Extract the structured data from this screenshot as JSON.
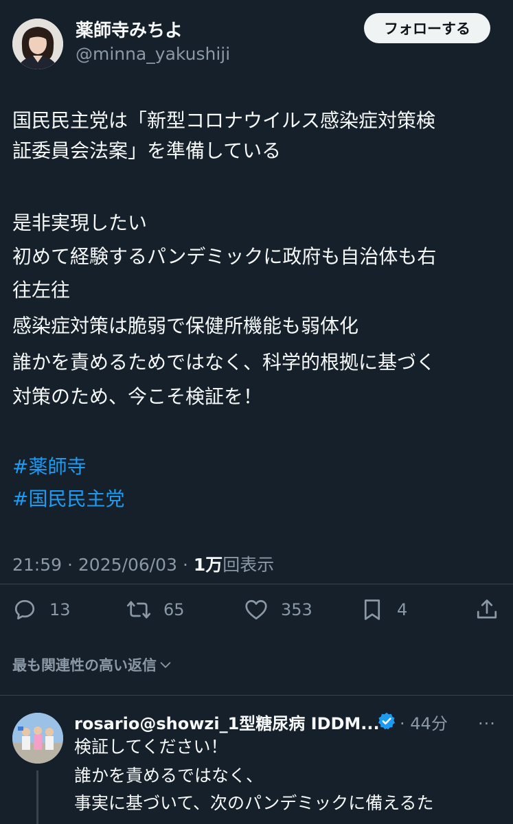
{
  "author": {
    "name": "薬師寺みちよ",
    "handle": "@minna_yakushiji"
  },
  "follow_button": "フォローする",
  "tweet": {
    "lines": [
      "国民民主党は「新型コロナウイルス感染症対策検",
      "証委員会法案」を準備している",
      "",
      "是非実現したい",
      "初めて経験するパンデミックに政府も自治体も右",
      "往左往",
      "感染症対策は脆弱で保健所機能も弱体化",
      "誰かを責めるためではなく、科学的根拠に基づく",
      "対策のため、今こそ検証を！"
    ],
    "hashtags": [
      "#薬師寺",
      "#国民民主党"
    ]
  },
  "meta": {
    "time": "21:59",
    "separator": "·",
    "date": "2025/06/03",
    "views_count": "1万",
    "views_label": "回表示"
  },
  "actions": {
    "reply": {
      "icon": "reply-icon",
      "count": "13"
    },
    "retweet": {
      "icon": "retweet-icon",
      "count": "65"
    },
    "like": {
      "icon": "heart-icon",
      "count": "353"
    },
    "bookmark": {
      "icon": "bookmark-icon",
      "count": "4"
    },
    "share": {
      "icon": "share-icon"
    }
  },
  "replies_filter": "最も関連性の高い返信",
  "reply": {
    "name": "rosario@showzi_1型糖尿病 IDDM...",
    "separator": "·",
    "time": "44分",
    "more": "···",
    "lines": [
      "検証してください！",
      "誰かを責めるではなく、",
      "事実に基づいて、次のパンデミックに備えるた"
    ]
  },
  "colors": {
    "background": "#15202b",
    "text": "#f7f9f9",
    "secondary": "#8b98a5",
    "accent": "#1d9bf0"
  }
}
